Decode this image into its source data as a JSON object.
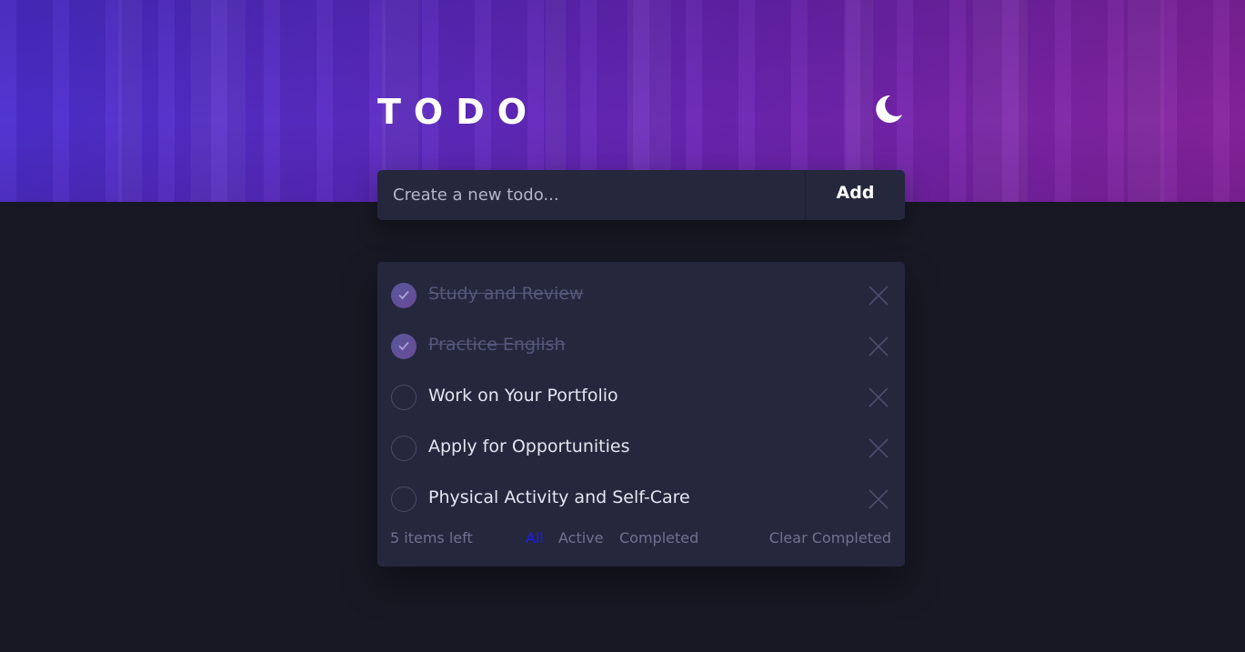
{
  "header": {
    "title": "TODO",
    "theme_icon": "moon-icon"
  },
  "new_todo": {
    "placeholder": "Create a new todo...",
    "value": "",
    "add_label": "Add"
  },
  "todos": [
    {
      "text": "Study and Review",
      "completed": true
    },
    {
      "text": "Practice English",
      "completed": true
    },
    {
      "text": "Work on Your Portfolio",
      "completed": false
    },
    {
      "text": "Apply for Opportunities",
      "completed": false
    },
    {
      "text": "Physical Activity and Self-Care",
      "completed": false
    }
  ],
  "footer": {
    "items_left": "5 items left",
    "filters": [
      "All",
      "Active",
      "Completed"
    ],
    "active_filter": "All",
    "clear_label": "Clear Completed"
  },
  "colors": {
    "background": "#181824",
    "card": "#25273c",
    "text": "#e4e5f1",
    "completed_text": "#55587a",
    "muted": "#6f7290",
    "active_filter": "#1a1aff"
  }
}
